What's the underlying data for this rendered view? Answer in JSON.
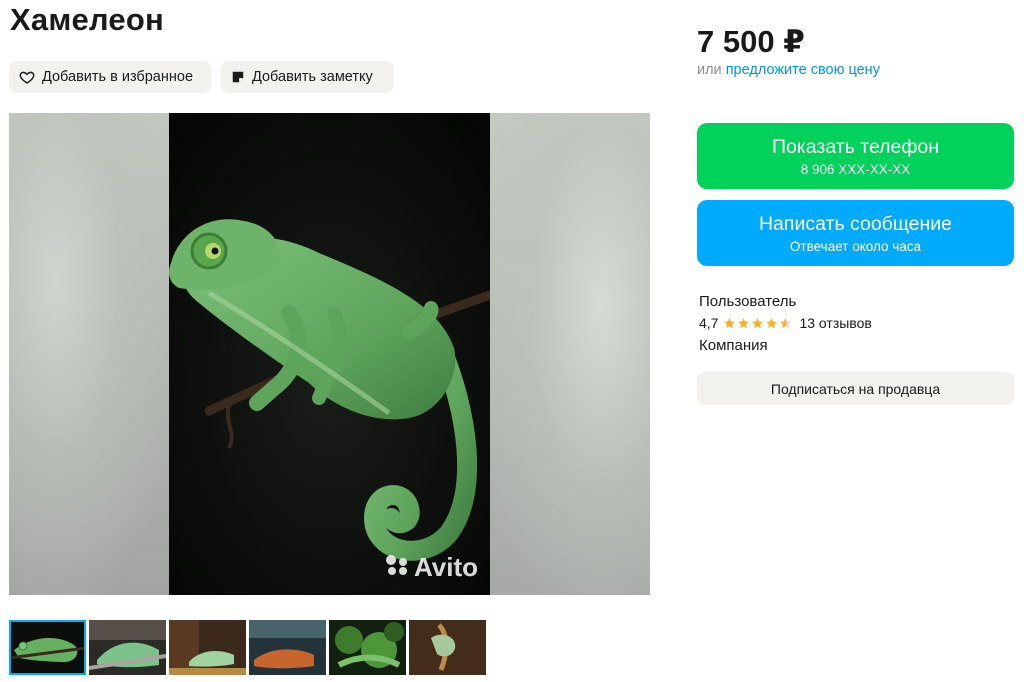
{
  "listing": {
    "title": "Хамелеон",
    "favorite_label": "Добавить в избранное",
    "note_label": "Добавить заметку",
    "watermark": "Avito",
    "thumbnail_count": 6
  },
  "sidebar": {
    "price": "7 500 ₽",
    "offer_prefix": "или",
    "offer_link": "предложите свою цену",
    "phone_button": {
      "label": "Показать телефон",
      "sub": "8 906 XXX-XX-XX"
    },
    "message_button": {
      "label": "Написать сообщение",
      "sub": "Отвечает около часа"
    },
    "seller": {
      "name": "Пользователь",
      "rating": "4,7",
      "rating_stars": 4.7,
      "reviews": "13 отзывов",
      "type": "Компания"
    },
    "subscribe_label": "Подписаться на продавца"
  },
  "colors": {
    "phone_button": "#02d15c",
    "message_button": "#00aaff",
    "link": "#0095e0",
    "star": "#ffb021"
  },
  "icons": [
    "heart-icon",
    "note-icon",
    "star-icon",
    "avito-logo-icon"
  ]
}
